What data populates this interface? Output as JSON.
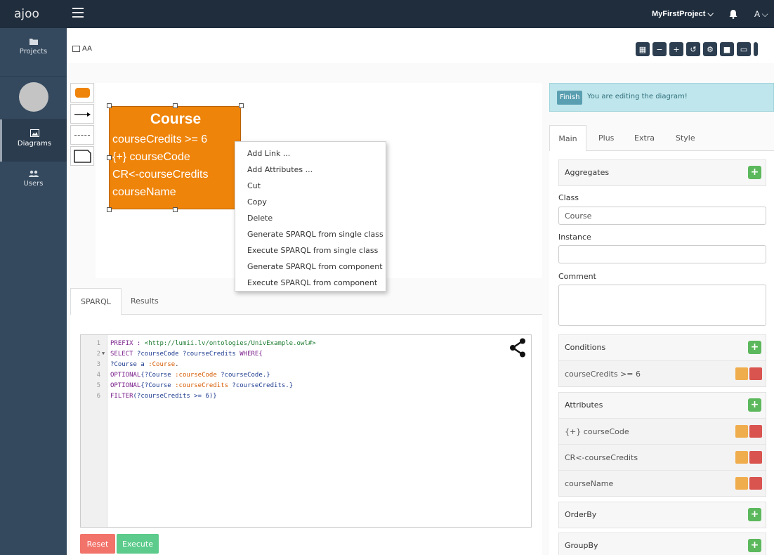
{
  "topbar": {
    "brand": "ajoo",
    "project": "MyFirstProject ⌵",
    "user": "A ⌵"
  },
  "sidebar": {
    "items": [
      {
        "label": "Projects"
      },
      {
        "label": "Diagrams"
      },
      {
        "label": "Users"
      }
    ]
  },
  "breadcrumb": {
    "label": "AA"
  },
  "node": {
    "title": "Course",
    "lines": [
      "courseCredits >= 6",
      "{+} courseCode",
      "CR<-courseCredits",
      "courseName"
    ]
  },
  "context_menu": {
    "items": [
      "Add Link ...",
      "Add Attributes ...",
      "Cut",
      "Copy",
      "Delete",
      "Generate SPARQL from single class",
      "Execute SPARQL from single class",
      "Generate SPARQL from component",
      "Execute SPARQL from component"
    ]
  },
  "bottom_tabs": {
    "sparql": "SPARQL",
    "results": "Results"
  },
  "editor": {
    "line_numbers": [
      "1",
      "2",
      "3",
      "4",
      "5",
      "6"
    ],
    "lines": [
      {
        "a": "PREFIX : ",
        "b": "<http://lumii.lv/ontologies/UnivExample.owl#>"
      },
      {
        "a": "SELECT ",
        "b": "?courseCode ?courseCredits ",
        "c": "WHERE{"
      },
      {
        "a": "?Course a ",
        "b": ":Course",
        "c": "."
      },
      {
        "a": "OPTIONAL",
        "b": "{?Course ",
        "c": ":courseCode",
        "d": " ?courseCode.}"
      },
      {
        "a": "OPTIONAL",
        "b": "{?Course ",
        "c": ":courseCredits",
        "d": " ?courseCredits.}"
      },
      {
        "a": "FILTER",
        "b": "(?courseCredits >= 6)}"
      }
    ]
  },
  "buttons": {
    "reset": "Reset",
    "execute": "Execute",
    "finish": "Finish"
  },
  "alert": {
    "message": "You are editing the diagram!"
  },
  "right_tabs": {
    "main": "Main",
    "plus": "Plus",
    "extra": "Extra",
    "style": "Style"
  },
  "form": {
    "aggregates": "Aggregates",
    "class_label": "Class",
    "class_value": "Course",
    "instance_label": "Instance",
    "instance_value": "",
    "comment_label": "Comment",
    "conditions": "Conditions",
    "condition_rows": [
      "courseCredits >= 6"
    ],
    "attributes": "Attributes",
    "attribute_rows": [
      "{+} courseCode",
      "CR<-courseCredits",
      "courseName"
    ],
    "orderby": "OrderBy",
    "groupby": "GroupBy"
  },
  "colors": {
    "topbar": "#1f2d3d",
    "sidebar": "#34495e",
    "node": "#ef840a",
    "add": "#5cb85c",
    "edit": "#f0ad4e",
    "delete": "#d9534f"
  }
}
